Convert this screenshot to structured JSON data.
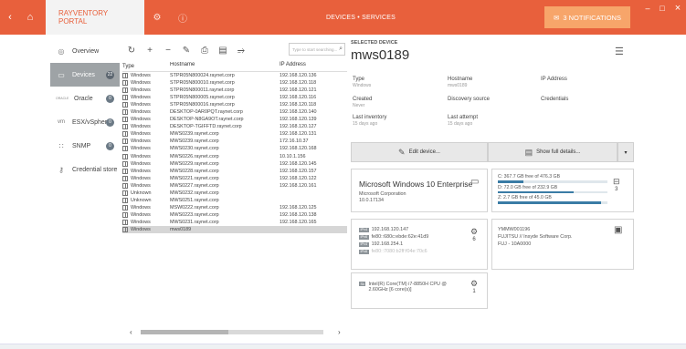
{
  "titlebar": {
    "back_icon": "chevron-left-icon",
    "home_icon": "home-icon",
    "app_name": "RAYVENTORY PORTAL",
    "center_title": "DEVICES • SERVICES",
    "notifications": "3 NOTIFICATIONS",
    "accent": "#e8603c"
  },
  "sidebar": {
    "items": [
      {
        "label": "Overview",
        "icon": "target-icon"
      },
      {
        "label": "Devices",
        "icon": "monitor-icon",
        "badge": "22"
      },
      {
        "label": "Oracle",
        "prefix": "ORACLE",
        "badge": "0"
      },
      {
        "label": "ESX/vSphere",
        "prefix": "vm",
        "badge": "0"
      },
      {
        "label": "SNMP",
        "icon": "snmp-icon",
        "badge": "0"
      },
      {
        "label": "Credential store",
        "icon": "key-icon"
      }
    ]
  },
  "search": {
    "placeholder": "Type to start searching..."
  },
  "list": {
    "headers": {
      "type": "Type",
      "host": "Hostname",
      "ip": "IP Address"
    },
    "rows": [
      {
        "type": "Windows",
        "host": "STPR05N800024.raynet.corp",
        "ip": "192.168.120.136"
      },
      {
        "type": "Windows",
        "host": "STPR05N800010.raynet.corp",
        "ip": "192.168.120.118"
      },
      {
        "type": "Windows",
        "host": "STPR05N800011.raynet.corp",
        "ip": "192.168.120.121"
      },
      {
        "type": "Windows",
        "host": "STPR05N800005.raynet.corp",
        "ip": "192.168.120.116"
      },
      {
        "type": "Windows",
        "host": "STPR05N800016.raynet.corp",
        "ip": "192.168.120.118"
      },
      {
        "type": "Windows",
        "host": "DESKTOP-0AR0PQT.raynet.corp",
        "ip": "192.168.120.140"
      },
      {
        "type": "Windows",
        "host": "DESKTOP-N8GA9OT.raynet.corp",
        "ip": "192.168.120.139"
      },
      {
        "type": "Windows",
        "host": "DESKTOP-TGIFFTD.raynet.corp",
        "ip": "192.168.120.127"
      },
      {
        "type": "Windows",
        "host": "MWS0239.raynet.corp",
        "ip": "192.168.120.131"
      },
      {
        "type": "Windows",
        "host": "MWS0239.raynet.corp",
        "ip": "172.16.10.37"
      },
      {
        "type": "Windows",
        "host": "MWS0230.raynet.corp",
        "ip": "192.168.120.168"
      },
      {
        "type": "Windows",
        "host": "MWS0226.raynet.corp",
        "ip": "10.10.1.156"
      },
      {
        "type": "Windows",
        "host": "MWS0229.raynet.corp",
        "ip": "192.168.120.145"
      },
      {
        "type": "Windows",
        "host": "MWS0228.raynet.corp",
        "ip": "192.168.120.157"
      },
      {
        "type": "Windows",
        "host": "MWS0221.raynet.corp",
        "ip": "192.168.120.122"
      },
      {
        "type": "Windows",
        "host": "MWS0227.raynet.corp",
        "ip": "192.168.120.161"
      },
      {
        "type": "Unknown",
        "host": "MWS0232.raynet.corp",
        "ip": ""
      },
      {
        "type": "Unknown",
        "host": "MWS0251.raynet.corp",
        "ip": ""
      },
      {
        "type": "Windows",
        "host": "MSW0222.raynet.corp",
        "ip": "192.168.120.125"
      },
      {
        "type": "Windows",
        "host": "MWS0223.raynet.corp",
        "ip": "192.168.120.138"
      },
      {
        "type": "Windows",
        "host": "MWS0231.raynet.corp",
        "ip": "192.168.120.165"
      },
      {
        "type": "Windows",
        "host": "mws0189",
        "ip": ""
      }
    ]
  },
  "detail": {
    "selected_label": "SELECTED DEVICE",
    "name": "mws0189",
    "type_label": "Type",
    "type_value": "Windows",
    "hostname_label": "Hostname",
    "hostname_value": "mws0189",
    "ip_label": "IP Address",
    "created_label": "Created",
    "created_value": "Never",
    "discovery_label": "Discovery source",
    "credentials_label": "Credentials",
    "last_inventory_label": "Last inventory",
    "last_inventory_value": "15 days ago",
    "last_attempt_label": "Last attempt",
    "last_attempt_value": "15 days ago",
    "edit_label": "Edit device...",
    "full_details_label": "Show full details...",
    "os_title": "Microsoft Windows 10 Enterprise",
    "os_vendor": "Microsoft Corporation",
    "os_version": "10.0.17134",
    "disks": [
      {
        "text": "C: 367.7 GB free of 476.3 GB",
        "used": 0.23
      },
      {
        "text": "D: 72.0 GB free of 232.9 GB",
        "used": 0.69
      },
      {
        "text": "Z: 2.7 GB free of 45.0 GB",
        "used": 0.94
      }
    ],
    "disk_count": "3",
    "net": [
      {
        "tag": "IPv4",
        "value": "192.168.120.147"
      },
      {
        "tag": "IPv6",
        "value": "fe80::680c:ebde:62e:41d9"
      },
      {
        "tag": "IPv4",
        "value": "192.168.254.1"
      },
      {
        "tag": "IPv6",
        "value": "fe80::7080:b2ff:f04e:70c6"
      }
    ],
    "net_count": "6",
    "bios_serial": "YMMW001196",
    "bios_vendor": "FUJITSU // Insyde Software Corp.",
    "bios_version": "FUJ    - 10A0000",
    "cpu_tag": "Sk",
    "cpu_line1": "Intel(R) Core(TM) i7-8850H CPU @",
    "cpu_line2": "2.60GHz [6 core(s)]",
    "cpu_count": "1"
  }
}
